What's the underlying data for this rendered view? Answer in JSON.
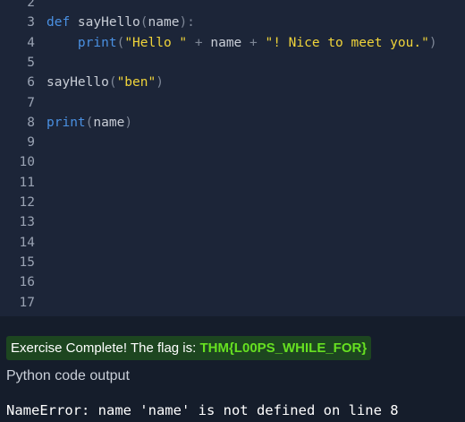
{
  "editor": {
    "lines": [
      {
        "n": "2",
        "parts": []
      },
      {
        "n": "3",
        "parts": [
          [
            "kw",
            "def"
          ],
          [
            "fn",
            " sayHello"
          ],
          [
            "op",
            "("
          ],
          [
            "fn",
            "name"
          ],
          [
            "op",
            "):"
          ]
        ]
      },
      {
        "n": "4",
        "parts": [
          [
            "fn",
            "    "
          ],
          [
            "kw",
            "print"
          ],
          [
            "op",
            "("
          ],
          [
            "str",
            "\"Hello \""
          ],
          [
            "op",
            " + "
          ],
          [
            "fn",
            "name"
          ],
          [
            "op",
            " + "
          ],
          [
            "str",
            "\"! Nice to meet you.\""
          ],
          [
            "op",
            ")"
          ]
        ]
      },
      {
        "n": "5",
        "parts": []
      },
      {
        "n": "6",
        "parts": [
          [
            "fn",
            "sayHello"
          ],
          [
            "op",
            "("
          ],
          [
            "str",
            "\"ben\""
          ],
          [
            "op",
            ")"
          ]
        ]
      },
      {
        "n": "7",
        "parts": []
      },
      {
        "n": "8",
        "parts": [
          [
            "kw",
            "print"
          ],
          [
            "op",
            "("
          ],
          [
            "fn",
            "name"
          ],
          [
            "op",
            ")"
          ]
        ]
      },
      {
        "n": "9",
        "parts": []
      },
      {
        "n": "10",
        "parts": []
      },
      {
        "n": "11",
        "parts": []
      },
      {
        "n": "12",
        "parts": []
      },
      {
        "n": "13",
        "parts": []
      },
      {
        "n": "14",
        "parts": []
      },
      {
        "n": "15",
        "parts": []
      },
      {
        "n": "16",
        "parts": []
      },
      {
        "n": "17",
        "parts": []
      }
    ]
  },
  "banner": {
    "text": "Exercise Complete! The flag is: ",
    "flag": "THM{L00PS_WHILE_FOR}"
  },
  "output": {
    "title": "Python code output",
    "text": "NameError: name 'name' is not defined on line 8"
  },
  "colors": {
    "editor_bg": "#1c2538",
    "panel_bg": "#151d2b",
    "keyword": "#4a90e2",
    "string": "#f0d43a",
    "flag": "#66e021",
    "banner_bg": "#1d4620"
  }
}
